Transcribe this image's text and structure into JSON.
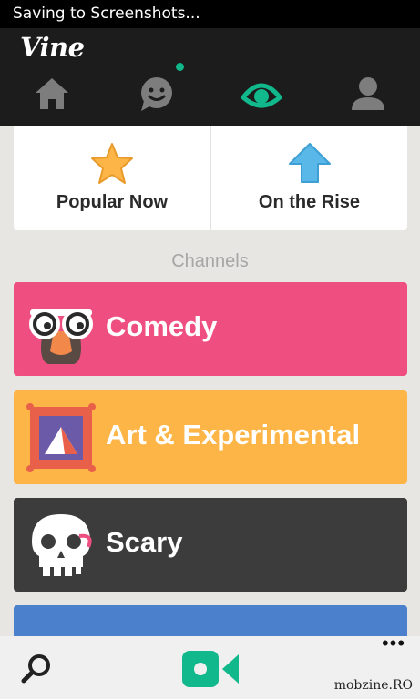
{
  "status_bar": {
    "text": "Saving to Screenshots..."
  },
  "app": {
    "logo": "Vine"
  },
  "nav": {
    "items": [
      {
        "icon": "home-icon"
      },
      {
        "icon": "activity-chat-icon",
        "has_notification": true
      },
      {
        "icon": "explore-eye-icon",
        "active": true
      },
      {
        "icon": "profile-icon"
      }
    ],
    "active_color": "#10b88c",
    "notification_color": "#10b88c"
  },
  "features": {
    "popular": {
      "label": "Popular Now",
      "icon": "star-icon"
    },
    "rising": {
      "label": "On the Rise",
      "icon": "up-arrow-icon"
    }
  },
  "channels": {
    "title": "Channels",
    "items": [
      {
        "label": "Comedy",
        "color": "#ef4f80",
        "icon": "groucho-glasses-icon"
      },
      {
        "label": "Art & Experimental",
        "color": "#fdb548",
        "icon": "framed-painting-icon"
      },
      {
        "label": "Scary",
        "color": "#3c3c3c",
        "icon": "skull-icon"
      },
      {
        "label": "",
        "color": "#4a80cc",
        "icon": "animal-ears-icon"
      }
    ]
  },
  "bottom_bar": {
    "more": "•••"
  },
  "watermark": "mobzine.RO"
}
